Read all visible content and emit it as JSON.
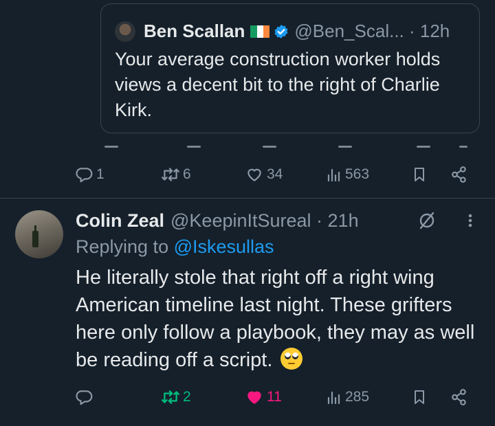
{
  "quoted_tweet": {
    "author_name": "Ben Scallan",
    "handle_time": "@Ben_Scal... · 12h",
    "text": "Your average construction worker holds views a decent bit to the right of Charlie Kirk."
  },
  "parent_actions": {
    "reply_count": "1",
    "repost_count": "6",
    "like_count": "34",
    "view_count": "563"
  },
  "reply_tweet": {
    "author_name": "Colin Zeal",
    "handle_time": "@KeepinItSureal · 21h",
    "replying_prefix": "Replying to ",
    "replying_to": "@Iskesullas",
    "text": "He literally stole that right off a right wing American timeline last night. These grifters here only follow a playbook, they may as well be reading off a script."
  },
  "reply_actions": {
    "reply_count": "",
    "repost_count": "2",
    "like_count": "11",
    "view_count": "285"
  },
  "colors": {
    "background": "#15202b",
    "muted": "#8b98a5",
    "link": "#1d9bf0",
    "repost_active": "#00ba7c",
    "like_active": "#f91880",
    "border": "#38444d"
  },
  "icons": [
    "reply-icon",
    "repost-icon",
    "like-icon",
    "views-icon",
    "bookmark-icon",
    "share-icon",
    "verified-badge-icon",
    "grok-icon",
    "more-icon",
    "eye-roll-emoji"
  ]
}
